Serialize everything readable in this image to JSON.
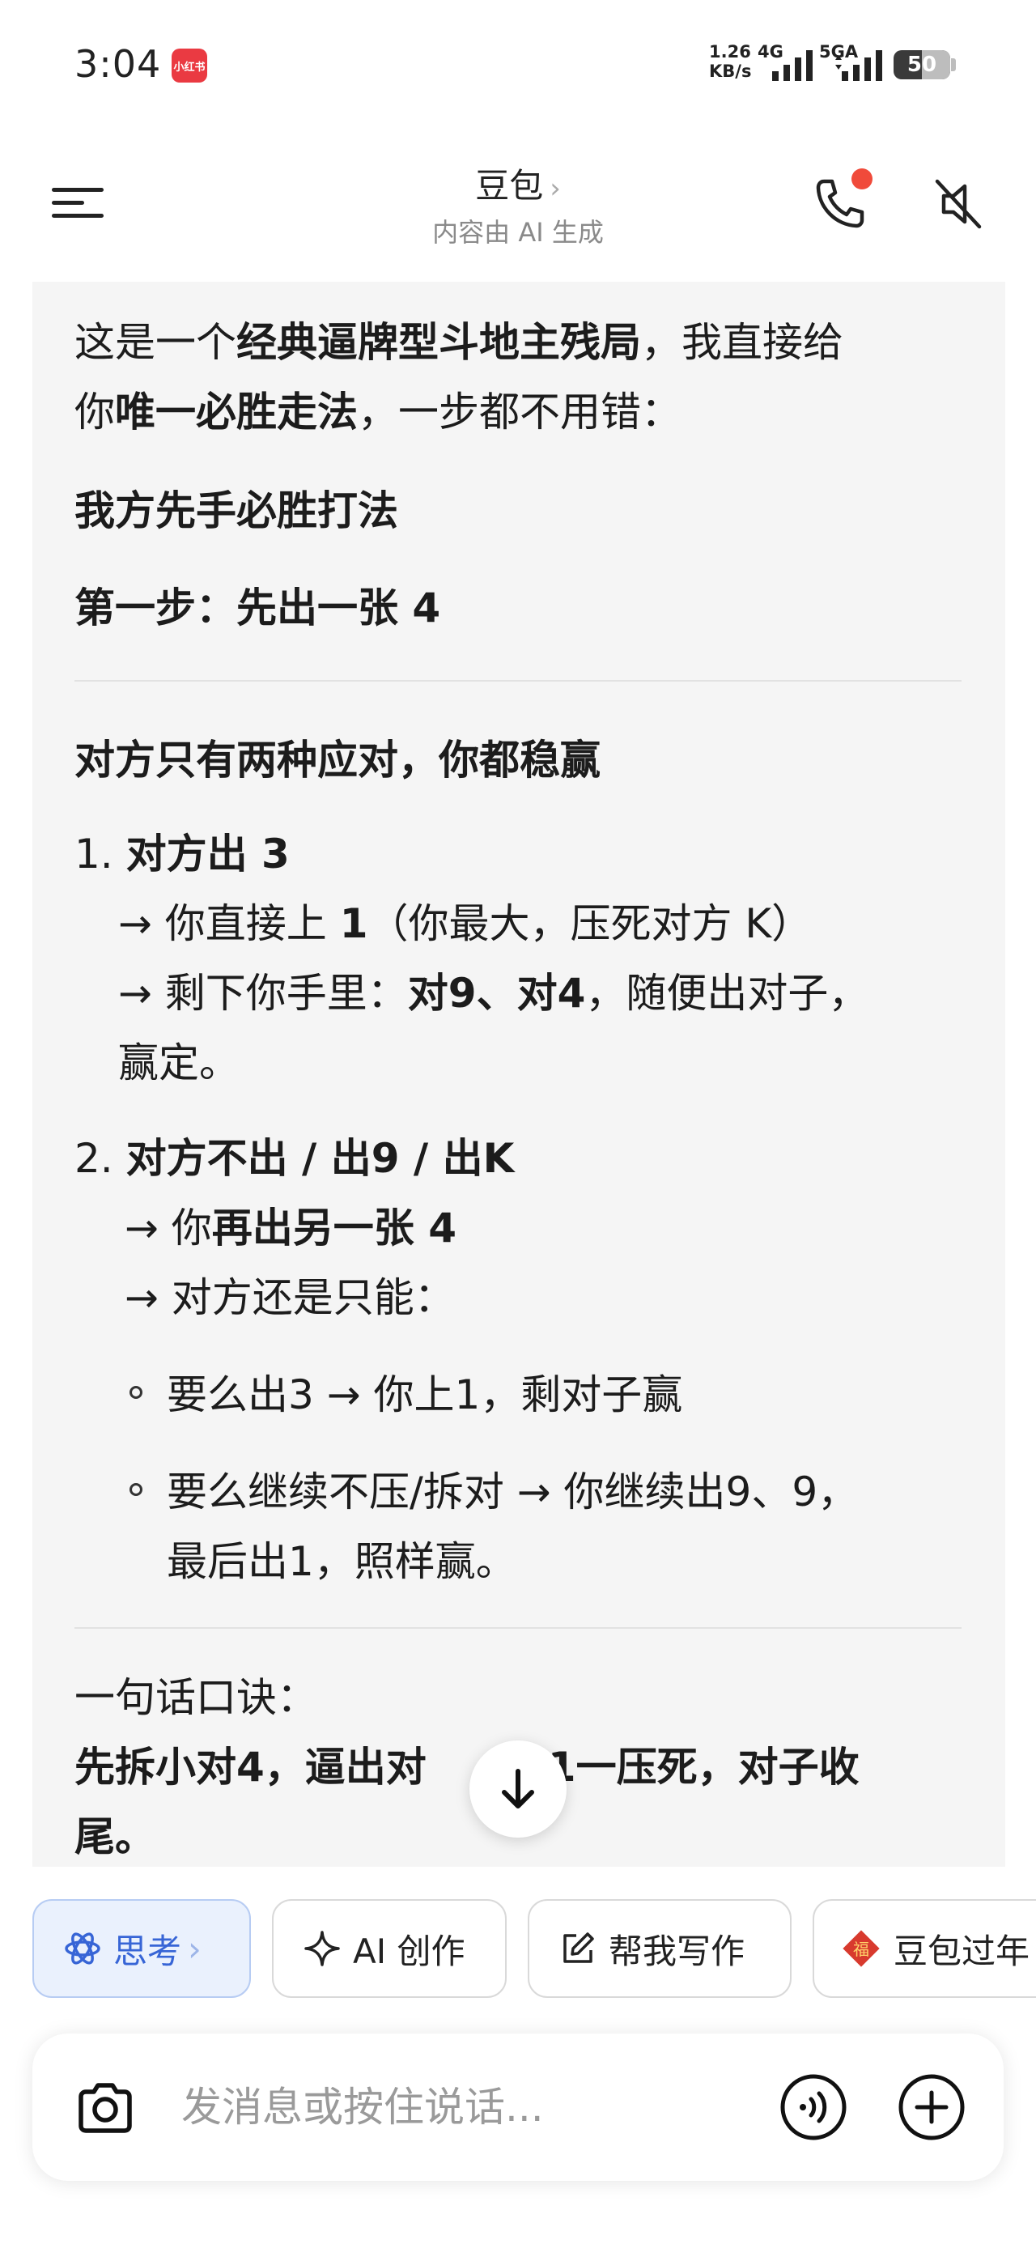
{
  "status": {
    "time": "3:04",
    "app_badge": "小红书",
    "net_speed_line1": "1.26",
    "net_speed_line2": "KB/s",
    "net_4g": "4G",
    "net_5g": "5GA",
    "battery": "50",
    "battery_level_percent": 50
  },
  "header": {
    "title": "豆包",
    "subtitle": "内容由 AI 生成"
  },
  "message": {
    "intro_a": "这是一个",
    "intro_b": "经典逼牌型斗地主残局",
    "intro_c": "，我直接给",
    "intro_d": "你",
    "intro_e": "唯一必胜走法",
    "intro_f": "，一步都不用错：",
    "heading1": "我方先手必胜打法",
    "step1": "第一步：先出一张 4",
    "heading2": "对方只有两种应对，你都稳赢",
    "item1_num": "1.",
    "item1_title": "对方出 3",
    "item1_l1_a": "→ 你直接上 ",
    "item1_l1_b": "1",
    "item1_l1_c": "（你最大，压死对方 K）",
    "item1_l2_a": "→ 剩下你手里：",
    "item1_l2_b": "对9、对4",
    "item1_l2_c": "，随便出对子，",
    "item1_l3": "赢定。",
    "item2_num": "2.",
    "item2_title": "对方不出 / 出9 / 出K",
    "item2_l1_a": "→ 你",
    "item2_l1_b": "再出另一张 4",
    "item2_l2": "→ 对方还是只能：",
    "bullet1": "要么出3 → 你上1，剩对子赢",
    "bullet2_l1": "要么继续不压/拆对 → 你继续出9、9，",
    "bullet2_l2": "最后出1，照样赢。",
    "motto_label": "一句话口诀：",
    "motto_l1_a": "先拆小对4，逼出对",
    "motto_l1_b": "1一压死，对子收",
    "motto_l2": "尾。"
  },
  "chips": [
    {
      "label": "思考",
      "icon": "atom-icon"
    },
    {
      "label": "AI 创作",
      "icon": "sparkle-icon"
    },
    {
      "label": "帮我写作",
      "icon": "edit-icon"
    },
    {
      "label": "豆包过年",
      "icon": "fu-icon"
    }
  ],
  "input": {
    "placeholder": "发消息或按住说话..."
  },
  "colors": {
    "accent": "#3765d6",
    "card_bg": "#f5f5f5",
    "notify_dot": "#f04a3a"
  }
}
